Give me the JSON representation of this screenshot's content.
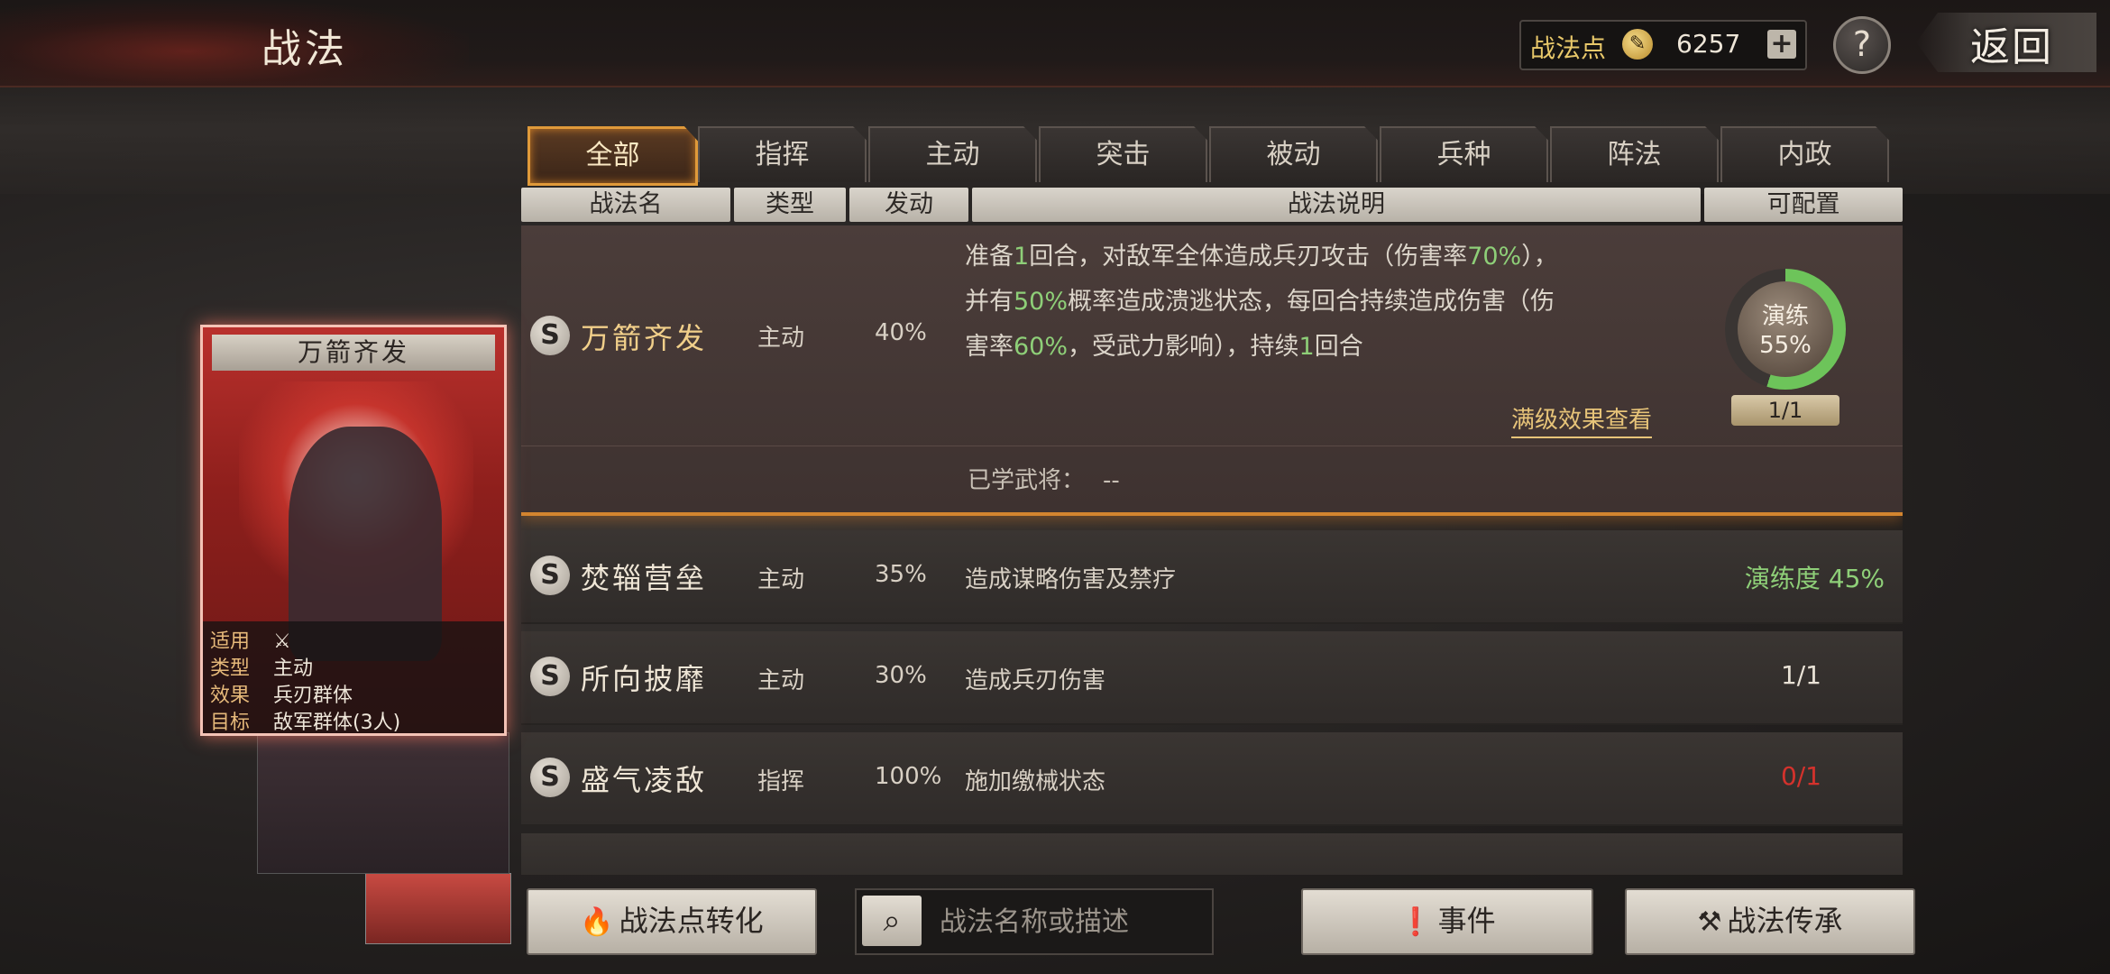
{
  "header": {
    "title": "战法",
    "points_label": "战法点",
    "points_value": "6257",
    "plus": "+",
    "help": "?",
    "back": "返回"
  },
  "tabs": [
    {
      "label": "全部",
      "active": true
    },
    {
      "label": "指挥",
      "active": false
    },
    {
      "label": "主动",
      "active": false
    },
    {
      "label": "突击",
      "active": false
    },
    {
      "label": "被动",
      "active": false
    },
    {
      "label": "兵种",
      "active": false
    },
    {
      "label": "阵法",
      "active": false
    },
    {
      "label": "内政",
      "active": false
    }
  ],
  "columns": [
    "战法名",
    "类型",
    "发动",
    "战法说明",
    "可配置"
  ],
  "expanded": {
    "badge": "S",
    "name": "万箭齐发",
    "type": "主动",
    "rate": "40%",
    "desc_1a": "准备",
    "desc_1b": "1",
    "desc_1c": "回合，对敌军全体造成兵刃攻击（伤害率",
    "desc_1d": "70%",
    "desc_1e": "），",
    "desc_2a": "并有",
    "desc_2b": "50%",
    "desc_2c": "概率造成溃逃状态，每回合持续造成伤害（伤",
    "desc_3a": "害率",
    "desc_3b": "60%",
    "desc_3c": "，受武力影响），持续",
    "desc_3d": "1",
    "desc_3e": "回合",
    "full_view": "满级效果查看",
    "learned_label": "已学武将：",
    "learned_value": "--",
    "drill_label": "演练",
    "drill_pct": "55%",
    "drill_progress": 0.55,
    "count": "1/1"
  },
  "rows": [
    {
      "badge": "S",
      "name": "焚辎营垒",
      "type": "主动",
      "rate": "35%",
      "desc": "造成谋略伤害及禁疗",
      "right": "演练度 45%",
      "right_color": "#8ecf78"
    },
    {
      "badge": "S",
      "name": "所向披靡",
      "type": "主动",
      "rate": "30%",
      "desc": "造成兵刃伤害",
      "right": "1/1",
      "right_color": "#e9e2d6"
    },
    {
      "badge": "S",
      "name": "盛气凌敌",
      "type": "指挥",
      "rate": "100%",
      "desc": "施加缴械状态",
      "right": "0/1",
      "right_color": "#d4322c"
    }
  ],
  "card": {
    "title": "万箭齐发",
    "info": [
      {
        "key": "适用",
        "val": "⚔"
      },
      {
        "key": "类型",
        "val": "主动"
      },
      {
        "key": "效果",
        "val": "兵刃群体"
      },
      {
        "key": "目标",
        "val": "敌军群体(3人)"
      }
    ]
  },
  "bottom": {
    "convert_label": "战法点转化",
    "search_placeholder": "战法名称或描述",
    "event_label": "事件",
    "inherit_label": "战法传承"
  },
  "colors": {
    "accent": "#e09a3a",
    "positive": "#8ecf78",
    "negative": "#d4322c"
  }
}
